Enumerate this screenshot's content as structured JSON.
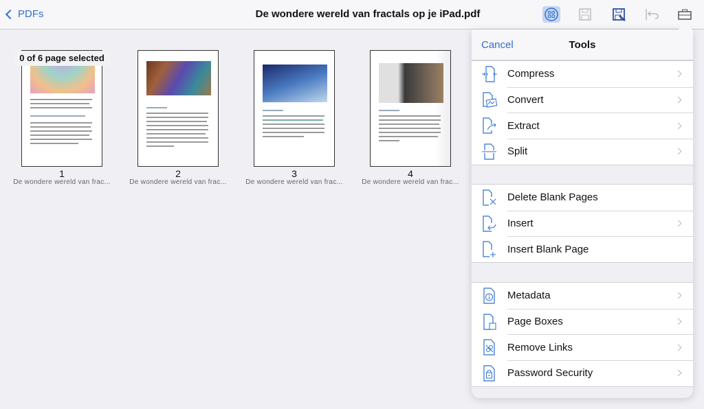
{
  "header": {
    "back_label": "PDFs",
    "title": "De wondere wereld van fractals op je iPad.pdf",
    "toolbar": [
      "grid-view-icon",
      "save-icon",
      "save-as-icon",
      "undo-icon",
      "toolbox-icon"
    ]
  },
  "selection": {
    "status": "0 of 6 page selected"
  },
  "pages": [
    {
      "number": "1",
      "caption": "De wondere wereld van frac..."
    },
    {
      "number": "2",
      "caption": "De wondere wereld van frac..."
    },
    {
      "number": "3",
      "caption": "De wondere wereld van frac..."
    },
    {
      "number": "4",
      "caption": "De wondere wereld van frac..."
    }
  ],
  "tools": {
    "cancel_label": "Cancel",
    "title": "Tools",
    "groups": [
      [
        {
          "label": "Compress",
          "chevron": true
        },
        {
          "label": "Convert",
          "chevron": true
        },
        {
          "label": "Extract",
          "chevron": true
        },
        {
          "label": "Split",
          "chevron": true
        }
      ],
      [
        {
          "label": "Delete Blank Pages",
          "chevron": false
        },
        {
          "label": "Insert",
          "chevron": true
        },
        {
          "label": "Insert Blank Page",
          "chevron": false
        }
      ],
      [
        {
          "label": "Metadata",
          "chevron": true
        },
        {
          "label": "Page Boxes",
          "chevron": true
        },
        {
          "label": "Remove Links",
          "chevron": true
        },
        {
          "label": "Password Security",
          "chevron": true
        }
      ]
    ]
  },
  "colors": {
    "accent": "#2f6fd0"
  }
}
